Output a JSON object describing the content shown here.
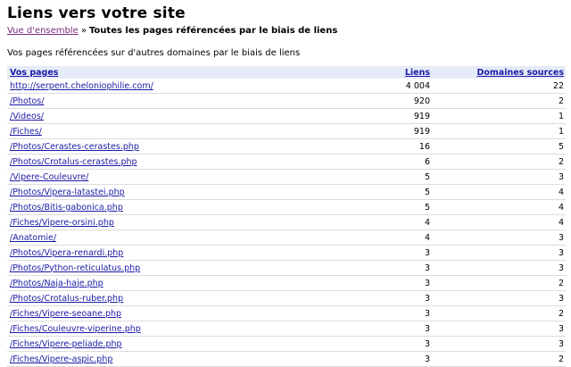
{
  "header": {
    "title": "Liens vers votre site"
  },
  "breadcrumb": {
    "parent": "Vue d'ensemble",
    "separator": "»",
    "current": "Toutes les pages référencées par le biais de liens"
  },
  "description": "Vos pages référencées sur d'autres domaines par le biais de liens",
  "table": {
    "columns": [
      "Vos pages",
      "Liens",
      "Domaines sources"
    ],
    "rows": [
      {
        "page": "http://serpent.cheloniophilie.com/",
        "links": "4 004",
        "domains": "22"
      },
      {
        "page": "/Photos/",
        "links": "920",
        "domains": "2"
      },
      {
        "page": "/Videos/",
        "links": "919",
        "domains": "1"
      },
      {
        "page": "/Fiches/",
        "links": "919",
        "domains": "1"
      },
      {
        "page": "/Photos/Cerastes-cerastes.php",
        "links": "16",
        "domains": "5"
      },
      {
        "page": "/Photos/Crotalus-cerastes.php",
        "links": "6",
        "domains": "2"
      },
      {
        "page": "/Vipere-Couleuvre/",
        "links": "5",
        "domains": "3"
      },
      {
        "page": "/Photos/Vipera-latastei.php",
        "links": "5",
        "domains": "4"
      },
      {
        "page": "/Photos/Bitis-gabonica.php",
        "links": "5",
        "domains": "4"
      },
      {
        "page": "/Fiches/Vipere-orsini.php",
        "links": "4",
        "domains": "4"
      },
      {
        "page": "/Anatomie/",
        "links": "4",
        "domains": "3"
      },
      {
        "page": "/Photos/Vipera-renardi.php",
        "links": "3",
        "domains": "3"
      },
      {
        "page": "/Photos/Python-reticulatus.php",
        "links": "3",
        "domains": "3"
      },
      {
        "page": "/Photos/Naja-haje.php",
        "links": "3",
        "domains": "2"
      },
      {
        "page": "/Photos/Crotalus-ruber.php",
        "links": "3",
        "domains": "3"
      },
      {
        "page": "/Fiches/Vipere-seoane.php",
        "links": "3",
        "domains": "2"
      },
      {
        "page": "/Fiches/Couleuvre-viperine.php",
        "links": "3",
        "domains": "3"
      },
      {
        "page": "/Fiches/Vipere-peliade.php",
        "links": "3",
        "domains": "3"
      },
      {
        "page": "/Fiches/Vipere-aspic.php",
        "links": "3",
        "domains": "2"
      }
    ]
  }
}
